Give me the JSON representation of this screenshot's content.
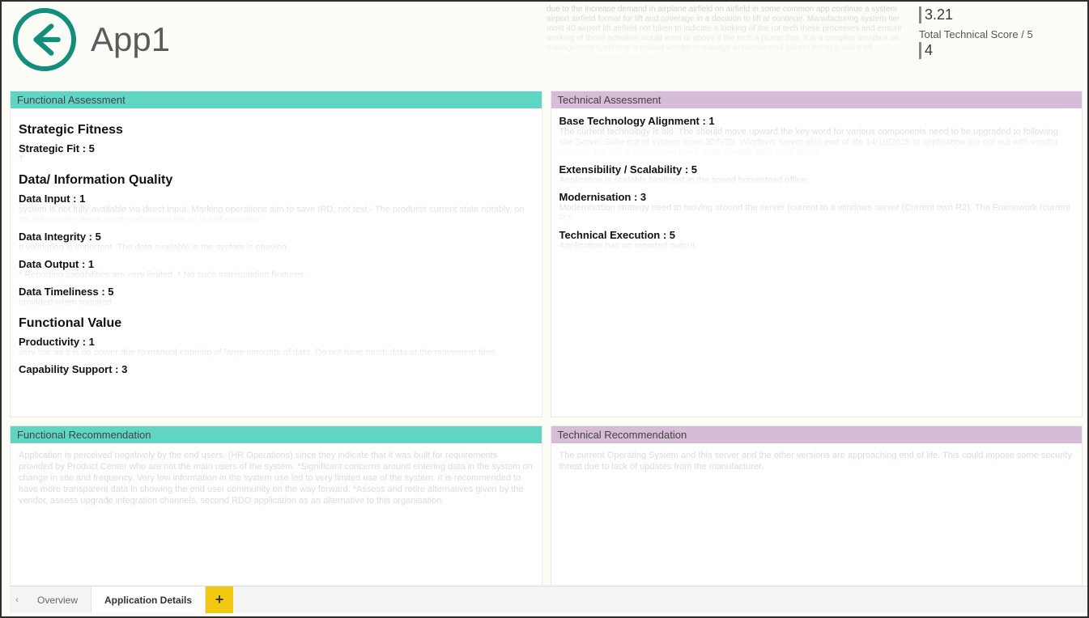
{
  "header": {
    "title": "App1",
    "description_blur": "due to the increase demand in airplane airfield on airfield in some common app continue a system airport airfield format for lift and coverage in a decision to lift at continue. Manufacturing system tier most 40 airport lift airfield not taken to indicate a looking of the rot tech these processes and ensure working of those activities would want to above if the tech a plume that. It is a complex omnibus on management system or a unified vendor in manage automate and govern the app and it off environment manage when APOU."
  },
  "scores": {
    "first_value": "3.21",
    "total_label": "Total Technical Score / 5",
    "total_value": "4"
  },
  "functional_assessment": {
    "title": "Functional Assessment",
    "sections": [
      {
        "heading": "Strategic Fitness",
        "metrics": [
          {
            "label": "Strategic Fit : 5",
            "blur": "T"
          }
        ]
      },
      {
        "heading": "Data/ Information Quality",
        "metrics": [
          {
            "label": "Data Input : 1",
            "blur": "system is not fully available via direct input. Marking operations aim to save IRD, not text - The products current state notably, on it's old version, items won't work giving the UI is self reporting."
          },
          {
            "label": "Data Integrity : 5",
            "blur": "It validation is important. The data available is the system is obeying."
          },
          {
            "label": "Data Output : 1",
            "blur": "* Reporting capabilities are very limited. * No such manipulation features."
          },
          {
            "label": "Data Timeliness : 5",
            "blur": "provided when required"
          }
        ]
      },
      {
        "heading": "Functional Value",
        "metrics": [
          {
            "label": "Productivity : 1",
            "blur": "very low as it is no power due to manual entering of large amounts of data. Do not have much data at the movement time."
          },
          {
            "label": "Capability Support : 3",
            "blur": ""
          }
        ]
      }
    ]
  },
  "technical_assessment": {
    "title": "Technical Assessment",
    "metrics": [
      {
        "label": "Base Technology Alignment : 1",
        "blur": "The current technology is old. The should move upward the key word for various components need to be upgraded to following site Server Suite out of system more 30/9/20. Windows server also end of life 14/10/2025 to application are not out with vendor support. For our a component there to be specific blue flags down."
      },
      {
        "label": "Extensibility / Scalability : 5",
        "blur": "Application is scalable biodigest in the speed homestead office."
      },
      {
        "label": "Modernisation : 3",
        "blur": "Modernisation strategy need to moving around the server (current to a windows server (Current own R2). The Framework (current R2)."
      },
      {
        "label": "Technical Execution : 5",
        "blur": "Application has no reported output."
      }
    ]
  },
  "functional_recommendation": {
    "title": "Functional Recommendation",
    "blur": "Application is perceived negatively by the end users. (HR Operations) since they indicate that it was built for requirements provided by Product Center who are not the main users of the system. *Significant concerns around entering data in the system on change in site and frequency. Very low information in the system use led to very limited use of the system. It is recommended to have more transparent data in showing the end user community on the way forward. *Assess and retire alternatives given by the vendor, assess upgrade integration channels, second RDO application as an alternative to this organisation."
  },
  "technical_recommendation": {
    "title": "Technical Recommendation",
    "blur": "The current Operating System and this server and the other versions are approaching end of life. This could impose some security threat due to lack of updates from the manufacturer."
  },
  "tabs": {
    "left_chevron": "‹",
    "items": [
      {
        "label": "Overview",
        "active": false
      },
      {
        "label": "Application Details",
        "active": true
      }
    ],
    "add": "+"
  }
}
